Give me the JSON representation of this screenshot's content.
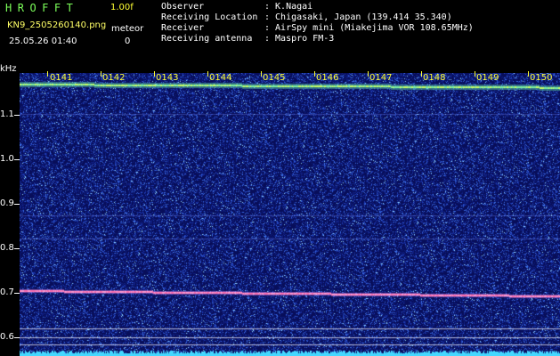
{
  "header": {
    "app_title": "HROFFT",
    "version": "1.00f",
    "filename": "KN9_2505260140.png",
    "timestamp": "25.05.26 01:40",
    "meteor_label": "meteor",
    "meteor_count": "0"
  },
  "info": [
    {
      "label": "Observer",
      "value": ": K.Nagai"
    },
    {
      "label": "Receiving Location",
      "value": ": Chigasaki, Japan (139.414 35.340)"
    },
    {
      "label": "Receiver",
      "value": ": AirSpy mini (Miakejima VOR 108.65MHz)"
    },
    {
      "label": "Receiving antenna",
      "value": ": Maspro FM-3"
    }
  ],
  "axis": {
    "unit": "kHz",
    "y_ticks": [
      "1.1",
      "1.0",
      "0.9",
      "0.8",
      "0.7",
      "0.6"
    ],
    "x_ticks": [
      "0141",
      "0142",
      "0143",
      "0144",
      "0145",
      "0146",
      "0147",
      "0148",
      "0149",
      "0150"
    ]
  },
  "colors": {
    "background": "#000000",
    "title": "#7cff5a",
    "tick": "#ffff33",
    "noise_base": "#0a1060"
  }
}
